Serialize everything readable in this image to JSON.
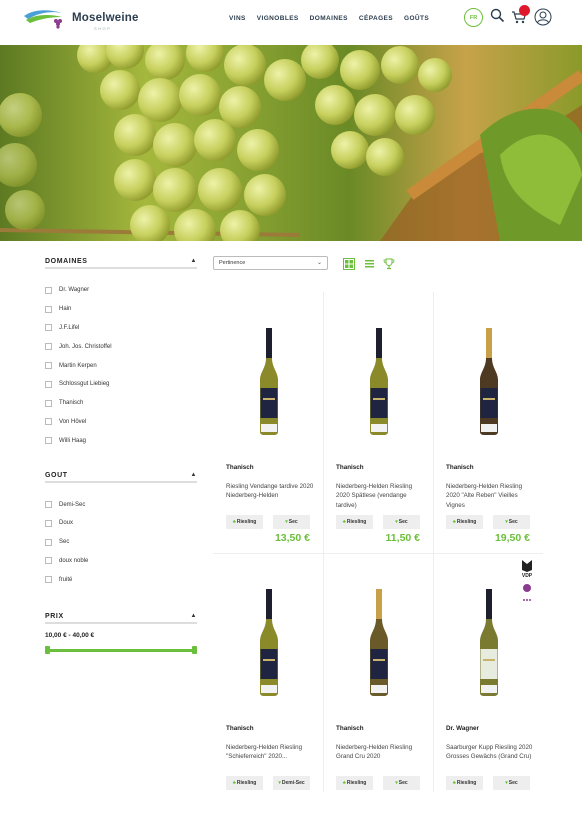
{
  "header": {
    "logo_name": "Moselweine",
    "logo_sub": "SHOP",
    "nav": [
      "VINS",
      "VIGNOBLES",
      "DOMAINES",
      "CÉPAGES",
      "GOÛTS"
    ],
    "lang": "FR"
  },
  "filters": {
    "domaines_title": "DOMAINES",
    "domaines": [
      "Dr. Wagner",
      "Hain",
      "J.F.Lifel",
      "Joh. Jos. Christoffel",
      "Martin Kerpen",
      "Schlossgut Liebieg",
      "Thanisch",
      "Von Hövel",
      "Willi Haag"
    ],
    "gout_title": "GOUT",
    "gout": [
      "Demi-Sec",
      "Doux",
      "Sec",
      "doux noble",
      "fruité"
    ],
    "prix_title": "PRIX",
    "prix_range": "10,00 € - 40,00 €",
    "prix_min_fraction": 0,
    "prix_max_fraction": 1
  },
  "toolbar": {
    "sort_value": "Pertinence"
  },
  "products": [
    {
      "producer": "Thanisch",
      "name": "Riesling Vendange tardive 2020 Niederberg-Helden",
      "grape": "Riesling",
      "taste": "Sec",
      "price": "13,50 €",
      "capsule": "#1d1f2e",
      "wine": "#8a8a2a"
    },
    {
      "producer": "Thanisch",
      "name": "Niederberg-Helden Riesling 2020 Spätlese (vendange tardive)",
      "grape": "Riesling",
      "taste": "Sec",
      "price": "11,50 €",
      "capsule": "#1d1f2e",
      "wine": "#8a8a2a"
    },
    {
      "producer": "Thanisch",
      "name": "Niederberg-Helden Riesling 2020 \"Alte Reben\" Vieilles Vignes",
      "grape": "Riesling",
      "taste": "Sec",
      "price": "19,50 €",
      "capsule": "#c8a04a",
      "wine": "#4e3a22"
    },
    {
      "producer": "Thanisch",
      "name": "Niederberg-Helden Riesling \"Schieferreich\" 2020...",
      "grape": "Riesling",
      "taste": "Demi-Sec",
      "price": "",
      "capsule": "#1d1f2e",
      "wine": "#8a8a2a"
    },
    {
      "producer": "Thanisch",
      "name": "Niederberg-Helden Riesling Grand Cru 2020",
      "grape": "Riesling",
      "taste": "Sec",
      "price": "",
      "capsule": "#c8a04a",
      "wine": "#6a5a2a"
    },
    {
      "producer": "Dr. Wagner",
      "name": "Saarburger Kupp Riesling 2020 Grosses Gewächs (Grand Cru)",
      "grape": "Riesling",
      "taste": "Sec",
      "price": "",
      "capsule": "#1d1f2e",
      "wine": "#7a7a30"
    }
  ],
  "badge": {
    "vdp": "VDP"
  },
  "colors": {
    "accent": "#6cbf3c",
    "navy": "#2b3d4f",
    "cart_badge": "#e0182d"
  }
}
